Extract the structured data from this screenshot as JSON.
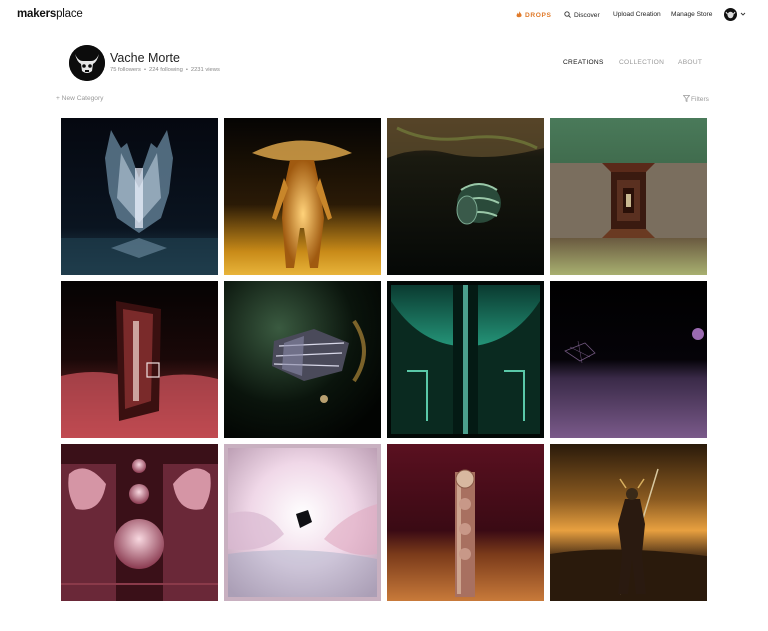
{
  "brand": {
    "logo_bold": "makers",
    "logo_light": "place"
  },
  "nav": {
    "drops": "DROPS",
    "discover": "Discover",
    "upload": "Upload Creation",
    "manage": "Manage Store"
  },
  "profile": {
    "name": "Vache Morte",
    "followers": "75 followers",
    "following": "224 following",
    "views": "2231 views"
  },
  "tabs": {
    "creations": "CREATIONS",
    "collection": "COLLECTION",
    "about": "ABOUT"
  },
  "toolbar": {
    "new_category": "+ New Category",
    "filters": "Filters"
  },
  "colors": {
    "accent_drops": "#e07a2a",
    "muted_text": "#999999"
  },
  "creations_count_shown": 12
}
